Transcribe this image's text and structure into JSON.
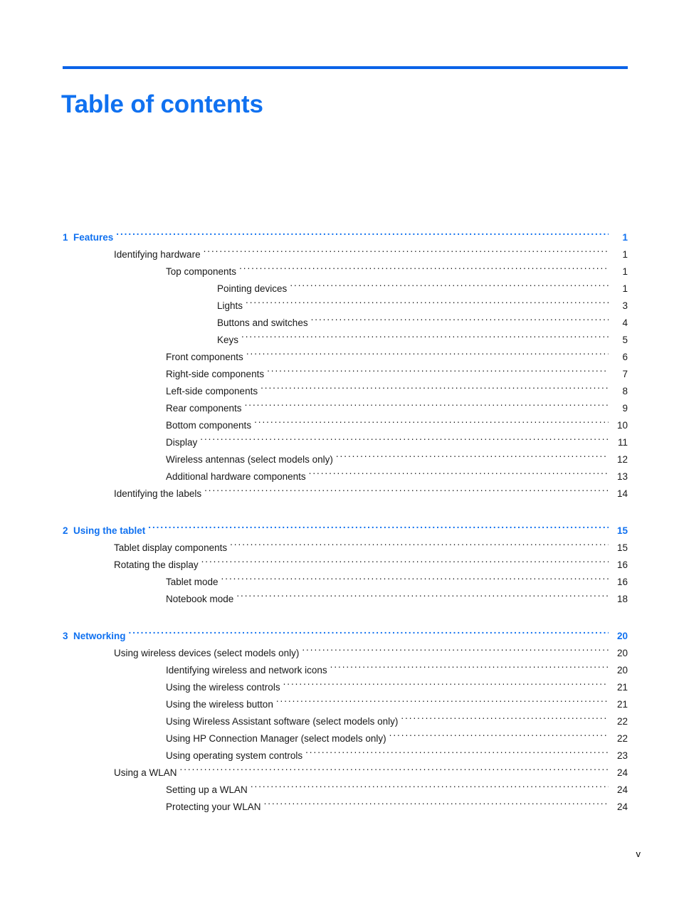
{
  "document": {
    "title": "Table of contents",
    "footer_page_label": "v",
    "accent_color": "#1071f0",
    "rule_color": "#0a63e8",
    "text_color": "#181818"
  },
  "toc": {
    "entries": [
      {
        "level": 0,
        "number": "1",
        "label": "Features",
        "page": "1"
      },
      {
        "level": 1,
        "number": "",
        "label": "Identifying hardware",
        "page": "1"
      },
      {
        "level": 2,
        "number": "",
        "label": "Top components",
        "page": "1"
      },
      {
        "level": 3,
        "number": "",
        "label": "Pointing devices",
        "page": "1"
      },
      {
        "level": 3,
        "number": "",
        "label": "Lights",
        "page": "3"
      },
      {
        "level": 3,
        "number": "",
        "label": "Buttons and switches",
        "page": "4"
      },
      {
        "level": 3,
        "number": "",
        "label": "Keys",
        "page": "5"
      },
      {
        "level": 2,
        "number": "",
        "label": "Front components",
        "page": "6"
      },
      {
        "level": 2,
        "number": "",
        "label": "Right-side components",
        "page": "7"
      },
      {
        "level": 2,
        "number": "",
        "label": "Left-side components",
        "page": "8"
      },
      {
        "level": 2,
        "number": "",
        "label": "Rear components",
        "page": "9"
      },
      {
        "level": 2,
        "number": "",
        "label": "Bottom components",
        "page": "10"
      },
      {
        "level": 2,
        "number": "",
        "label": "Display",
        "page": "11"
      },
      {
        "level": 2,
        "number": "",
        "label": "Wireless antennas (select models only)",
        "page": "12"
      },
      {
        "level": 2,
        "number": "",
        "label": "Additional hardware components",
        "page": "13"
      },
      {
        "level": 1,
        "number": "",
        "label": "Identifying the labels",
        "page": "14"
      },
      {
        "level": 0,
        "number": "2",
        "label": "Using the tablet",
        "page": "15"
      },
      {
        "level": 1,
        "number": "",
        "label": "Tablet display components",
        "page": "15"
      },
      {
        "level": 1,
        "number": "",
        "label": "Rotating the display",
        "page": "16"
      },
      {
        "level": 2,
        "number": "",
        "label": "Tablet mode",
        "page": "16"
      },
      {
        "level": 2,
        "number": "",
        "label": "Notebook mode",
        "page": "18"
      },
      {
        "level": 0,
        "number": "3",
        "label": "Networking",
        "page": "20"
      },
      {
        "level": 1,
        "number": "",
        "label": "Using wireless devices (select models only)",
        "page": "20"
      },
      {
        "level": 2,
        "number": "",
        "label": "Identifying wireless and network icons",
        "page": "20"
      },
      {
        "level": 2,
        "number": "",
        "label": "Using the wireless controls",
        "page": "21"
      },
      {
        "level": 2,
        "number": "",
        "label": "Using the wireless button",
        "page": "21"
      },
      {
        "level": 2,
        "number": "",
        "label": "Using Wireless Assistant software (select models only)",
        "page": "22"
      },
      {
        "level": 2,
        "number": "",
        "label": "Using HP Connection Manager (select models only)",
        "page": "22"
      },
      {
        "level": 2,
        "number": "",
        "label": "Using operating system controls",
        "page": "23"
      },
      {
        "level": 1,
        "number": "",
        "label": "Using a WLAN",
        "page": "24"
      },
      {
        "level": 2,
        "number": "",
        "label": "Setting up a WLAN",
        "page": "24"
      },
      {
        "level": 2,
        "number": "",
        "label": "Protecting your WLAN",
        "page": "24"
      }
    ]
  }
}
